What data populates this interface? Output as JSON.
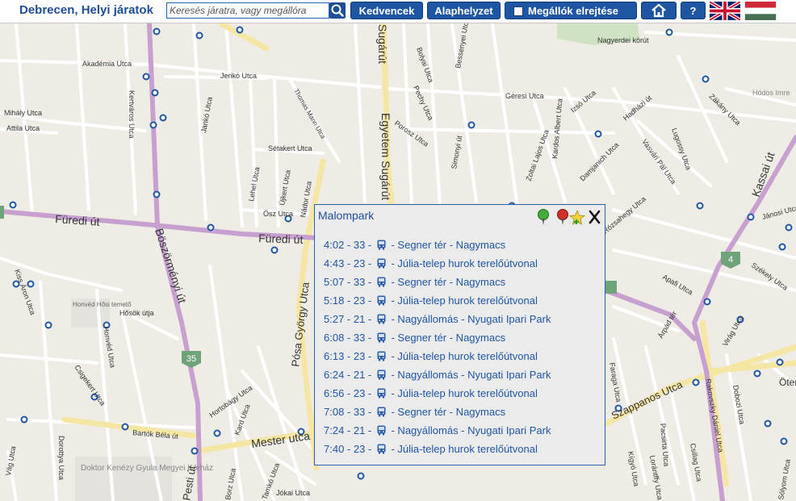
{
  "header": {
    "title": "Debrecen, Helyi járatok",
    "search_placeholder": "Keresés járatra, vagy megállóra",
    "favorites_label": "Kedvencek",
    "home_label": "Alaphelyzet",
    "hide_stops_label": "Megállók elrejtése",
    "help_label": "?"
  },
  "popup": {
    "stop_name": "Malompark",
    "departures": [
      {
        "time": "4:02",
        "route": "33",
        "destination": "Segner tér - Nagymacs"
      },
      {
        "time": "4:43",
        "route": "23",
        "destination": "Júlia-telep hurok terelőútvonal"
      },
      {
        "time": "5:07",
        "route": "33",
        "destination": "Segner tér - Nagymacs"
      },
      {
        "time": "5:18",
        "route": "23",
        "destination": "Júlia-telep hurok terelőútvonal"
      },
      {
        "time": "5:27",
        "route": "21",
        "destination": "Nagyállomás - Nyugati Ipari Park"
      },
      {
        "time": "6:08",
        "route": "33",
        "destination": "Segner tér - Nagymacs"
      },
      {
        "time": "6:13",
        "route": "23",
        "destination": "Júlia-telep hurok terelőútvonal"
      },
      {
        "time": "6:24",
        "route": "21",
        "destination": "Nagyállomás - Nyugati Ipari Park"
      },
      {
        "time": "6:56",
        "route": "23",
        "destination": "Júlia-telep hurok terelőútvonal"
      },
      {
        "time": "7:08",
        "route": "33",
        "destination": "Segner tér - Nagymacs"
      },
      {
        "time": "7:24",
        "route": "21",
        "destination": "Nagyállomás - Nyugati Ipari Park"
      },
      {
        "time": "7:40",
        "route": "23",
        "destination": "Júlia-telep hurok terelőútvonal"
      }
    ],
    "icons": [
      "green-pin-icon",
      "red-pin-icon",
      "add-favorite-icon",
      "close-icon"
    ]
  },
  "map": {
    "street_labels": [
      {
        "text": "Füredi út"
      },
      {
        "text": "Füredi út"
      },
      {
        "text": "Mester utca"
      },
      {
        "text": "Böszörményi út"
      },
      {
        "text": "Egyetem Sugárút"
      },
      {
        "text": "Sugárút"
      },
      {
        "text": "Akadémia Utca"
      },
      {
        "text": "Jerikó Utca"
      },
      {
        "text": "Mihály Utca"
      },
      {
        "text": "Attila Utca"
      },
      {
        "text": "Kertváros Utca"
      },
      {
        "text": "Sétakert Utca"
      },
      {
        "text": "Ösz Utca"
      },
      {
        "text": "Nádor Utca"
      },
      {
        "text": "Lehel Utca"
      },
      {
        "text": "Újkert Utca"
      },
      {
        "text": "Jankó Utca"
      },
      {
        "text": "Thomas Mann Utca"
      },
      {
        "text": "Pósa György Utca"
      },
      {
        "text": "Kiss Áron Utca"
      },
      {
        "text": "Hősök útja"
      },
      {
        "text": "Csigekert Utca"
      },
      {
        "text": "Bartók Béla út"
      },
      {
        "text": "Honvéd Utca"
      },
      {
        "text": "Hortobágy Utca"
      },
      {
        "text": "Kard Utca"
      },
      {
        "text": "Dorottya Utca"
      },
      {
        "text": "Vág Utca"
      },
      {
        "text": "Doktor Kenézy Gyula Megyei Kórház"
      },
      {
        "text": "Honvéd Hősi temető"
      },
      {
        "text": "Pesti út"
      },
      {
        "text": "Borz Utca"
      },
      {
        "text": "Tamkó Utca"
      },
      {
        "text": "Jókai Utca"
      },
      {
        "text": "Pechy Utca"
      },
      {
        "text": "Porosz Utca"
      },
      {
        "text": "Simonyi út"
      },
      {
        "text": "Bessenyei Utca"
      },
      {
        "text": "Bolyai Utca"
      },
      {
        "text": "Géresi Utca"
      },
      {
        "text": "Kardos Albert Utca"
      },
      {
        "text": "Izsó Utca"
      },
      {
        "text": "Hadházi út"
      },
      {
        "text": "Zoltai Lajos Utca"
      },
      {
        "text": "Damjanich Utca"
      },
      {
        "text": "Vasvári Pál Utca"
      },
      {
        "text": "Lugossy Utca"
      },
      {
        "text": "Rózsahegy Utca"
      },
      {
        "text": "Zákány Utca"
      },
      {
        "text": "Kassai út"
      },
      {
        "text": "Jánosi Utca"
      },
      {
        "text": "Székely Utca"
      },
      {
        "text": "Apafi Utca"
      },
      {
        "text": "Árpád tér"
      },
      {
        "text": "Virág Utca"
      },
      {
        "text": "Faraga Utca"
      },
      {
        "text": "Szappanos Utca"
      },
      {
        "text": "Pacsirta Utca"
      },
      {
        "text": "Csillag Utca"
      },
      {
        "text": "Rakovszky Dániel Utca"
      },
      {
        "text": "Dobozi Utca"
      },
      {
        "text": "Kígyó Utca"
      },
      {
        "text": "Lorántffy Utca"
      },
      {
        "text": "Nagyerdei körút"
      },
      {
        "text": "Hódos Imre"
      },
      {
        "text": "Ötemető Utca"
      },
      {
        "text": "Sólyom Utca"
      }
    ],
    "route_badges": [
      {
        "text": "35"
      },
      {
        "text": "4"
      }
    ]
  }
}
